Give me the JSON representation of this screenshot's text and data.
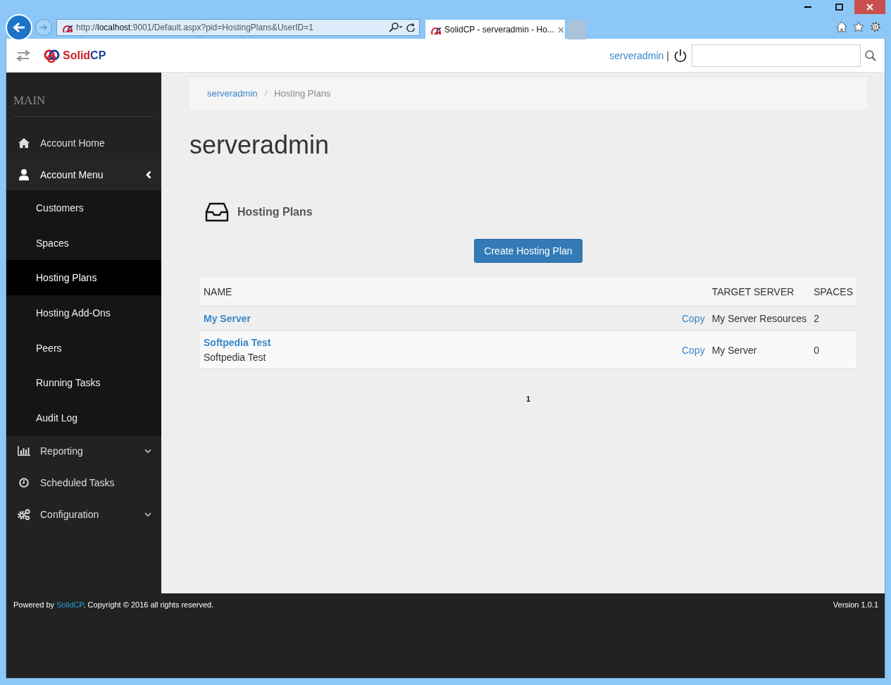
{
  "browser": {
    "url": {
      "scheme": "http://",
      "host": "localhost",
      "path": ":9001/Default.aspx?pid=HostingPlans&UserID=1"
    },
    "tabs": [
      {
        "title": "SolidCP - serveradmin - Ho...",
        "selected": true
      }
    ]
  },
  "header": {
    "logo": [
      "Solid",
      "CP"
    ],
    "user": "serveradmin",
    "separator": "|"
  },
  "sidebar": {
    "heading": "MAIN",
    "items": [
      {
        "label": "Account Home"
      },
      {
        "label": "Account Menu",
        "expanded": true,
        "children": [
          {
            "label": "Customers",
            "selected": false
          },
          {
            "label": "Spaces",
            "selected": false
          },
          {
            "label": "Hosting Plans",
            "selected": true
          },
          {
            "label": "Hosting Add-Ons",
            "selected": false
          },
          {
            "label": "Peers",
            "selected": false
          },
          {
            "label": "Running Tasks",
            "selected": false
          },
          {
            "label": "Audit Log",
            "selected": false
          }
        ]
      },
      {
        "label": "Reporting",
        "expanded": false
      },
      {
        "label": "Scheduled Tasks"
      },
      {
        "label": "Configuration",
        "expanded": false
      }
    ]
  },
  "breadcrumb": {
    "separator": "/",
    "items": [
      {
        "label": "serveradmin",
        "kind": "link"
      },
      {
        "label": "Hosting Plans",
        "kind": "current"
      }
    ]
  },
  "page_title": "serveradmin",
  "panel": {
    "title": "Hosting Plans",
    "button": "Create Hosting Plan",
    "table": {
      "columns": [
        "NAME",
        "TARGET SERVER",
        "SPACES"
      ],
      "rows": [
        {
          "name": "My Server",
          "action": "Copy",
          "target_server": "My Server Resources",
          "spaces": "2"
        },
        {
          "name": "Softpedia Test",
          "description": "Softpedia Test",
          "action": "Copy",
          "target_server": "My Server",
          "spaces": "0"
        }
      ]
    },
    "pages": [
      {
        "label": "1",
        "selected": true
      }
    ]
  },
  "footer": {
    "prefix": "Powered by ",
    "link": "SolidCP",
    "suffix": ". Copyright © 2016 all rights reserved.",
    "version": "Version 1.0.1"
  }
}
